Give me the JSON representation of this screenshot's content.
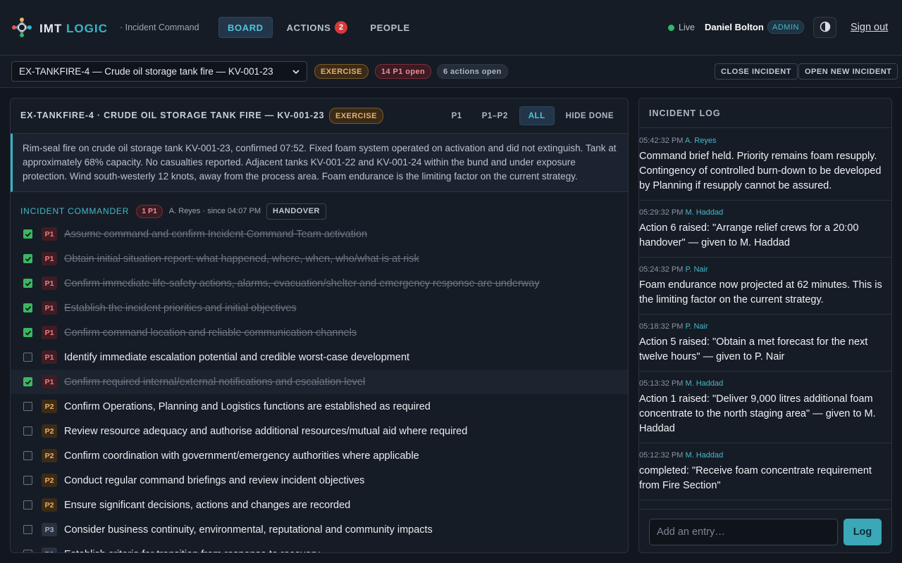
{
  "app": {
    "brand_main": "IMT",
    "brand_accent": "LOGIC",
    "subtitle": "· Incident Command"
  },
  "nav": {
    "tabs": [
      {
        "label": "BOARD",
        "active": true
      },
      {
        "label": "ACTIONS",
        "badge": "2"
      },
      {
        "label": "PEOPLE"
      }
    ]
  },
  "user": {
    "live_label": "Live",
    "name": "Daniel Bolton",
    "role": "ADMIN",
    "signout": "Sign out"
  },
  "subbar": {
    "selected_incident": "EX-TANKFIRE-4 — Crude oil storage tank fire — KV-001-23",
    "exercise": "EXERCISE",
    "p1_open": "14 P1 open",
    "actions_open": "6 actions open",
    "close_incident": "CLOSE INCIDENT",
    "open_new": "OPEN NEW INCIDENT"
  },
  "board": {
    "title": "EX-TANKFIRE-4 · CRUDE OIL STORAGE TANK FIRE — KV-001-23",
    "exercise": "EXERCISE",
    "filters": [
      "P1",
      "P1–P2",
      "ALL",
      "HIDE DONE"
    ],
    "active_filter": "ALL",
    "summary": "Rim-seal fire on crude oil storage tank KV-001-23, confirmed 07:52. Fixed foam system operated on activation and did not extinguish. Tank at approximately 68% capacity. No casualties reported. Adjacent tanks KV-001-22 and KV-001-24 within the bund and under exposure protection. Wind south-westerly 12 knots, away from the process area. Foam endurance is the limiting factor on the current strategy.",
    "role": {
      "name": "INCIDENT COMMANDER",
      "p1": "1 P1",
      "meta": "A. Reyes · since 04:07 PM",
      "handover": "HANDOVER"
    },
    "tasks": [
      {
        "prio": "P1",
        "text": "Assume command and confirm Incident Command Team activation",
        "done": true
      },
      {
        "prio": "P1",
        "text": "Obtain initial situation report: what happened, where, when, who/what is at risk",
        "done": true
      },
      {
        "prio": "P1",
        "text": "Confirm immediate life-safety actions, alarms, evacuation/shelter and emergency response are underway",
        "done": true
      },
      {
        "prio": "P1",
        "text": "Establish the incident priorities and initial objectives",
        "done": true
      },
      {
        "prio": "P1",
        "text": "Confirm command location and reliable communication channels",
        "done": true
      },
      {
        "prio": "P1",
        "text": "Identify immediate escalation potential and credible worst-case development",
        "done": false
      },
      {
        "prio": "P1",
        "text": "Confirm required internal/external notifications and escalation level",
        "done": true
      },
      {
        "prio": "P2",
        "text": "Confirm Operations, Planning and Logistics functions are established as required",
        "done": false
      },
      {
        "prio": "P2",
        "text": "Review resource adequacy and authorise additional resources/mutual aid where required",
        "done": false
      },
      {
        "prio": "P2",
        "text": "Confirm coordination with government/emergency authorities where applicable",
        "done": false
      },
      {
        "prio": "P2",
        "text": "Conduct regular command briefings and review incident objectives",
        "done": false
      },
      {
        "prio": "P2",
        "text": "Ensure significant decisions, actions and changes are recorded",
        "done": false
      },
      {
        "prio": "P3",
        "text": "Consider business continuity, environmental, reputational and community impacts",
        "done": false
      },
      {
        "prio": "P3",
        "text": "Establish criteria for transition from response to recovery",
        "done": false
      }
    ]
  },
  "log": {
    "title": "INCIDENT LOG",
    "entries": [
      {
        "time": "05:42:32 PM",
        "who": "A. Reyes",
        "text": "Command brief held. Priority remains foam resupply. Contingency of controlled burn-down to be developed by Planning if resupply cannot be assured."
      },
      {
        "time": "05:29:32 PM",
        "who": "M. Haddad",
        "text": "Action 6 raised: \"Arrange relief crews for a 20:00 handover\" — given to M. Haddad"
      },
      {
        "time": "05:24:32 PM",
        "who": "P. Nair",
        "text": "Foam endurance now projected at 62 minutes. This is the limiting factor on the current strategy."
      },
      {
        "time": "05:18:32 PM",
        "who": "P. Nair",
        "text": "Action 5 raised: \"Obtain a met forecast for the next twelve hours\" — given to P. Nair"
      },
      {
        "time": "05:13:32 PM",
        "who": "M. Haddad",
        "text": "Action 1 raised: \"Deliver 9,000 litres additional foam concentrate to the north staging area\" — given to M. Haddad"
      },
      {
        "time": "05:12:32 PM",
        "who": "M. Haddad",
        "text": "completed: \"Receive foam concentrate requirement from Fire Section\""
      }
    ],
    "input_placeholder": "Add an entry…",
    "submit": "Log"
  },
  "colors": {
    "accent": "#35b6c9",
    "background": "#12171f",
    "done_check": "#3bb662",
    "p1": "#f07c88",
    "p2": "#e9b06a"
  }
}
